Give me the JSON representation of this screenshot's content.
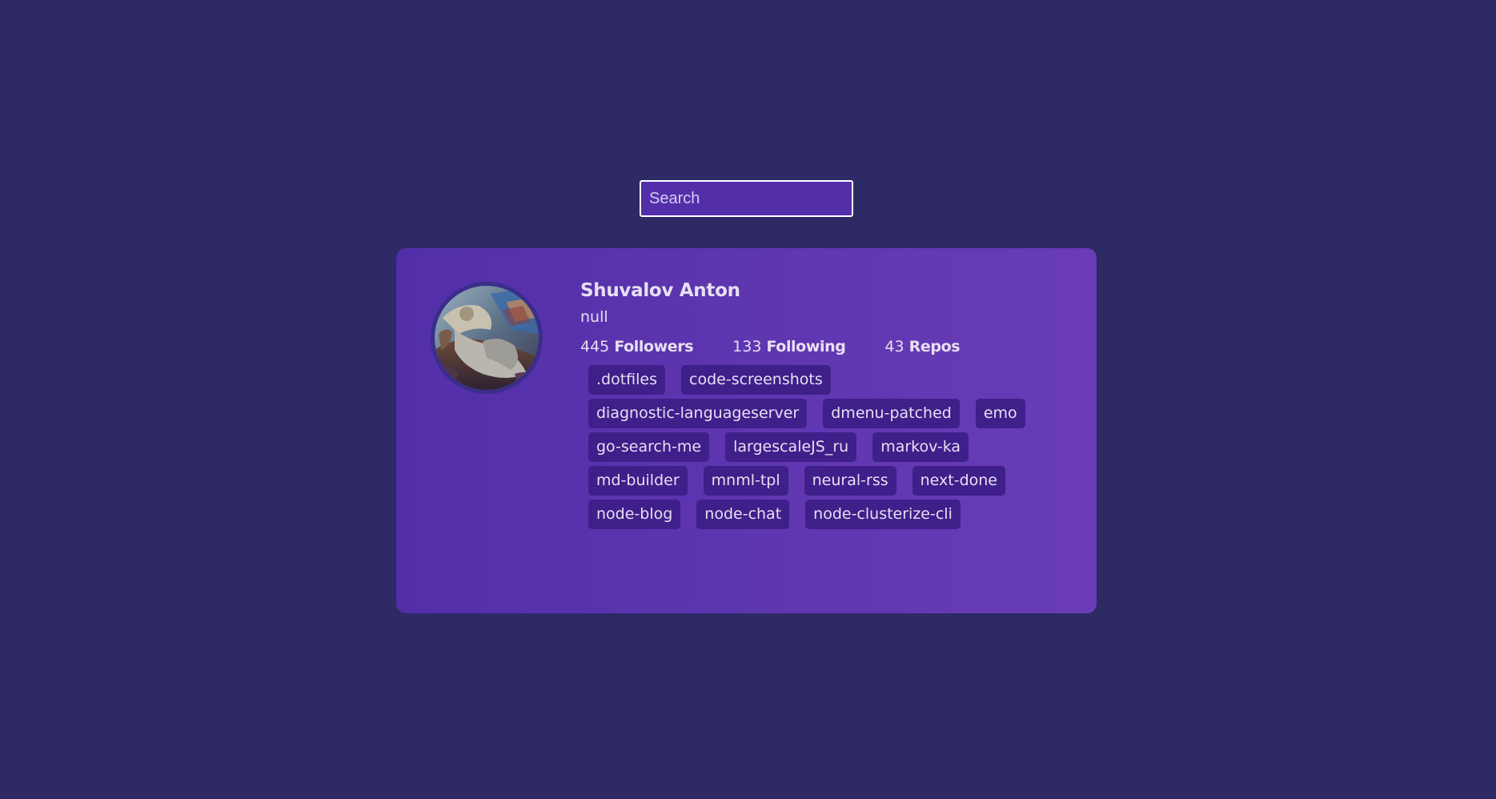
{
  "search": {
    "placeholder": "Search",
    "value": ""
  },
  "profile": {
    "avatar_alt": "user-avatar",
    "name": "Shuvalov Anton",
    "bio": "null",
    "stats": {
      "followers_count": "445",
      "followers_label": "Followers",
      "following_count": "133",
      "following_label": "Following",
      "repos_count": "43",
      "repos_label": "Repos"
    }
  },
  "repos": [
    ".dotfiles",
    "code-screenshots",
    "diagnostic-languageserver",
    "dmenu-patched",
    "emo",
    "go-search-me",
    "largescaleJS_ru",
    "markov-ka",
    "md-builder",
    "mnml-tpl",
    "neural-rss",
    "next-done",
    "node-blog",
    "node-chat",
    "node-clusterize-cli"
  ],
  "colors": {
    "background": "#2d2a66",
    "card": "#522fa9",
    "card_end": "#6a3cb7",
    "repo_tag": "#3f1f8a",
    "text": "#e6e0f2"
  }
}
